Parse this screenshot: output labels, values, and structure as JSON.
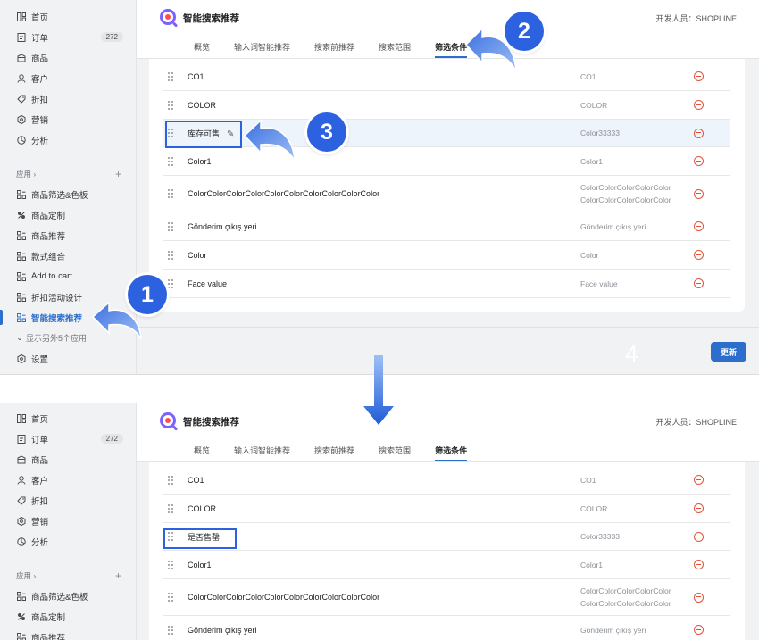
{
  "colors": {
    "primary": "#2c6ecb",
    "annotation_blue": "#2c62e0",
    "remove_red": "#e0533b",
    "muted_text": "#8c9196"
  },
  "sidebar": {
    "items": [
      {
        "label": "首页",
        "icon": "home-icon"
      },
      {
        "label": "订单",
        "icon": "order-icon",
        "badge": "272"
      },
      {
        "label": "商品",
        "icon": "product-icon"
      },
      {
        "label": "客户",
        "icon": "customer-icon"
      },
      {
        "label": "折扣",
        "icon": "discount-icon"
      },
      {
        "label": "营销",
        "icon": "marketing-icon"
      },
      {
        "label": "分析",
        "icon": "analytics-icon"
      }
    ],
    "apps_label": "应用 ›",
    "apps_add": "+",
    "apps": [
      {
        "label": "商品筛选&色板"
      },
      {
        "label": "商品定制"
      },
      {
        "label": "商品推荐"
      },
      {
        "label": "款式组合"
      },
      {
        "label": "Add to cart"
      },
      {
        "label": "折扣活动设计"
      },
      {
        "label": "智能搜索推荐"
      }
    ],
    "show_more": "显示另外5个应用",
    "settings": "设置"
  },
  "header": {
    "title": "智能搜索推荐",
    "developer": "开发人员：SHOPLINE",
    "tabs": [
      "概览",
      "输入词智能推荐",
      "搜索前推荐",
      "搜索范围",
      "筛选条件"
    ]
  },
  "table_top": {
    "rows": [
      {
        "name": "CO1",
        "value": "CO1"
      },
      {
        "name": "COLOR",
        "value": "COLOR"
      },
      {
        "name": "库存可售",
        "value": "Color33333"
      },
      {
        "name": "Color1",
        "value": "Color1"
      },
      {
        "name": "ColorColorColorColorColorColorColorColorColorColor",
        "value": "ColorColorColorColorColor",
        "value2": "ColorColorColorColorColor"
      },
      {
        "name": "Gönderim çıkış yeri",
        "value": "Gönderim çıkış yeri"
      },
      {
        "name": "Color",
        "value": "Color"
      },
      {
        "name": "Face value",
        "value": "Face value"
      }
    ]
  },
  "table_bottom": {
    "rows": [
      {
        "name": "CO1",
        "value": "CO1"
      },
      {
        "name": "COLOR",
        "value": "COLOR"
      },
      {
        "name": "是否售罄",
        "value": "Color33333"
      },
      {
        "name": "Color1",
        "value": "Color1"
      },
      {
        "name": "ColorColorColorColorColorColorColorColorColorColor",
        "value": "ColorColorColorColorColor",
        "value2": "ColorColorColorColorColor"
      },
      {
        "name": "Gönderim çıkış yeri",
        "value": "Gönderim çıkış yeri"
      }
    ]
  },
  "save_button": "更新",
  "annotations": {
    "step1": "1",
    "step2": "2",
    "step3": "3",
    "step4": "4"
  }
}
